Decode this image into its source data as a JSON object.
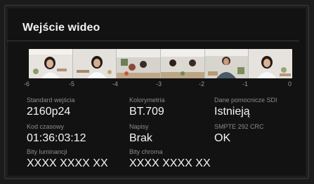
{
  "header": {
    "title": "Wejście wideo"
  },
  "filmstrip": {
    "tick_labels": [
      "-6",
      "-5",
      "-4",
      "-3",
      "-2",
      "-1",
      "0"
    ],
    "frames": [
      {
        "description_icon": "woman-frame-icon"
      },
      {
        "description_icon": "woman-frame-icon"
      },
      {
        "description_icon": "kitchen-frame-icon"
      },
      {
        "description_icon": "kitchen-frame-icon"
      },
      {
        "description_icon": "man-frame-icon"
      },
      {
        "description_icon": "woman-frame-icon"
      }
    ]
  },
  "info": {
    "input_standard": {
      "label": "Standard wejścia",
      "value": "2160p24"
    },
    "colorimetry": {
      "label": "Kolorymetria",
      "value": "BT.709"
    },
    "ancillary": {
      "label": "Dane pomocnicze SDI",
      "value": "Istnieją"
    },
    "timecode": {
      "label": "Kod czasowy",
      "value": "01:36:03:12"
    },
    "captions": {
      "label": "Napisy",
      "value": "Brak"
    },
    "smpte": {
      "label": "SMPTE 292 CRC",
      "value": "OK"
    },
    "luma_bits": {
      "label": "Bity luminancji",
      "value": "XXXX XXXX XX"
    },
    "chroma_bits": {
      "label": "Bity chroma",
      "value": "XXXX XXXX XX"
    }
  },
  "colors": {
    "background": "#121212",
    "label": "#8b8b8b",
    "value": "#f5f5f5"
  }
}
